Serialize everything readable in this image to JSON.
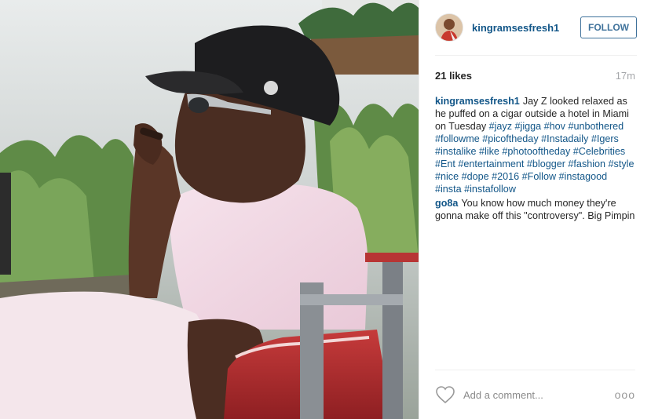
{
  "post": {
    "username": "kingramsesfresh1",
    "follow_label": "FOLLOW",
    "likes": "21 likes",
    "time": "17m",
    "comments": [
      {
        "user": "kingramsesfresh1",
        "text": "Jay Z looked relaxed as he puffed on a cigar outside a hotel in Miami on Tuesday",
        "hashtags": "#jayz #jigga #hov #unbothered #followme #picoftheday #Instadaily #Igers #instalike #like #photooftheday #Celebrities #Ent #entertainment #blogger #fashion #style #nice #dope #2016 #Follow #instagood #insta #instafollow"
      },
      {
        "user": "go8a",
        "text": "You know how much money they're gonna make off this \"controversy\". Big Pimpin",
        "hashtags": ""
      }
    ],
    "add_comment_placeholder": "Add a comment...",
    "more_label": "ooo"
  },
  "icons": {
    "like": "heart-icon",
    "more": "more-options-icon"
  },
  "colors": {
    "username": "#125688",
    "follow_border": "#3f729b",
    "muted": "#a5a7aa"
  }
}
